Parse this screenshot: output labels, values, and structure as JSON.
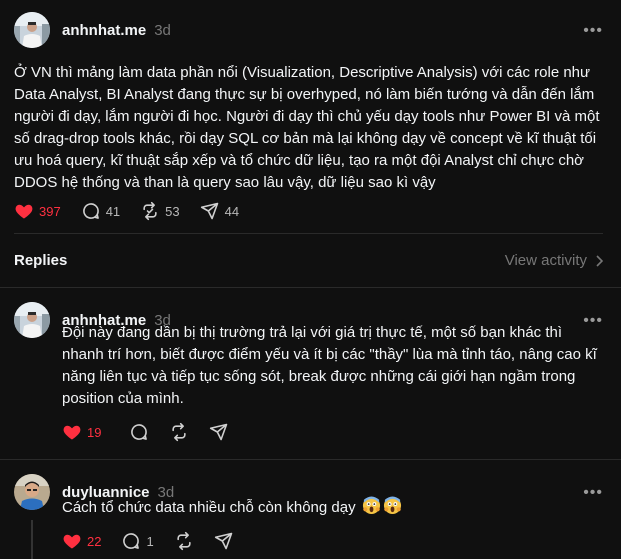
{
  "main_post": {
    "username": "anhnhat.me",
    "time": "3d",
    "text": "Ở VN thì mảng làm data phần nổi (Visualization, Descriptive Analysis) với các role như Data Analyst, BI Analyst đang thực sự bị overhyped, nó làm biến tướng và dẫn đến lắm người đi dạy, lắm người đi học. Người đi dạy thì chủ yếu dạy tools như Power BI và một số drag-drop tools khác, rồi dạy SQL cơ bản mà lại không dạy về concept về kĩ thuật tối ưu hoá query, kĩ thuật sắp xếp và tổ chức dữ liệu, tạo ra một đội Analyst chỉ chực chờ DDOS hệ thống và than là query sao lâu vậy, dữ liệu sao kì vậy",
    "likes": "397",
    "comments": "41",
    "reposts": "53",
    "shares": "44",
    "more_label": "•••"
  },
  "replies_bar": {
    "title": "Replies",
    "view_activity": "View activity"
  },
  "replies": [
    {
      "username": "anhnhat.me",
      "time": "3d",
      "text": "Đội này đang dần bị thị trường trả lại với giá trị thực tế, một số bạn khác thì nhanh trí hơn, biết được điểm yếu và ít bị các \"thầy\" lùa mà tỉnh táo, nâng cao kĩ năng liên tục và tiếp tục sống sót, break được những cái giới hạn ngầm trong position của mình.",
      "likes": "19",
      "more_label": "•••"
    },
    {
      "username": "duyluannice",
      "time": "3d",
      "text": "Cách tổ chức data nhiều chỗ còn không dạy",
      "emojis": [
        "face-screaming-in-fear",
        "face-screaming-in-fear"
      ],
      "likes": "22",
      "comments": "1",
      "more_label": "•••"
    }
  ],
  "colors": {
    "background": "#101010",
    "like_red": "#ff3040",
    "muted": "#777777",
    "divider": "#2a2a2a"
  }
}
